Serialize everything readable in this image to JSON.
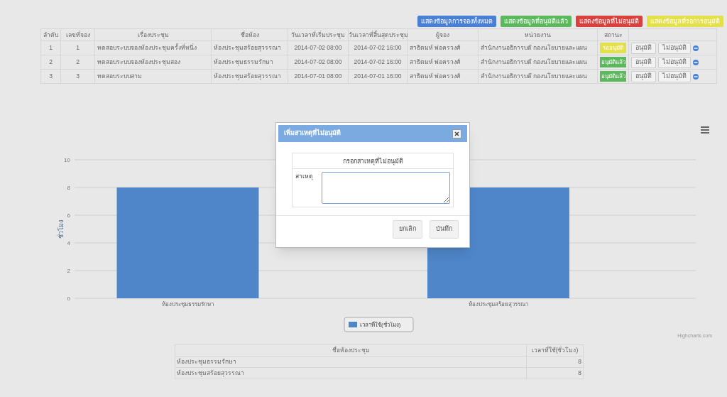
{
  "filter_buttons": [
    {
      "label": "แสดงข้อมูลการจองทั้งหมด",
      "color": "#4a7fd6"
    },
    {
      "label": "แสดงข้อมูลที่อนุมัติแล้ว",
      "color": "#5cb85c"
    },
    {
      "label": "แสดงข้อมูลที่ไม่อนุมัติ",
      "color": "#d9413f"
    },
    {
      "label": "แสดงข้อมูลที่รอการอนุมัติ",
      "color": "#e3e04a"
    }
  ],
  "bookings": {
    "columns": [
      "ลำดับ",
      "เลขที่จอง",
      "เรื่องประชุม",
      "ชื่อห้อง",
      "วันเวลาที่เริ่มประชุม",
      "วันเวลาที่สิ้นสุดประชุม",
      "ผู้จอง",
      "หน่วยงาน",
      "สถานะ"
    ],
    "rows": [
      {
        "cells": [
          "1",
          "1",
          "ทดสอบระบบจองห้องประชุมครั้งที่หนึ่ง",
          "ห้องประชุมสร้อยสุวรรณา",
          "2014-07-02 08:00",
          "2014-07-02 16:00",
          "สาธิตมห์ พ่อครวงศ์",
          "สำนักงานอธิการบดี กองนโยบายและแผน"
        ],
        "status": {
          "text": "รออนุมัติ",
          "color": "#e3e04a"
        },
        "approve": "อนุมัติ",
        "reject": "ไม่อนุมัติ"
      },
      {
        "cells": [
          "2",
          "2",
          "ทดสอบระบบจองห้องประชุมสอง",
          "ห้องประชุมธรรมรักษา",
          "2014-07-02 08:00",
          "2014-07-02 16:00",
          "สาธิตมห์ พ่อครวงศ์",
          "สำนักงานอธิการบดี กองนโยบายและแผน"
        ],
        "status": {
          "text": "อนุมัติแล้ว",
          "color": "#5cb85c"
        },
        "approve": "อนุมัติ",
        "reject": "ไม่อนุมัติ"
      },
      {
        "cells": [
          "3",
          "3",
          "ทดสอบระบบสาม",
          "ห้องประชุมสร้อยสุวรรณา",
          "2014-07-01 08:00",
          "2014-07-01 16:00",
          "สาธิตมห์ พ่อครวงศ์",
          "สำนักงานอธิการบดี กองนโยบายและแผน"
        ],
        "status": {
          "text": "อนุมัติแล้ว",
          "color": "#5cb85c"
        },
        "approve": "อนุมัติ",
        "reject": "ไม่อนุมัติ"
      }
    ]
  },
  "chart": {
    "credits": "Highcharts.com",
    "chart_data": {
      "type": "bar",
      "grid": true,
      "ylabel": "ชั่วโมง",
      "categories": [
        "ห้องประชุมธรรมรักษา",
        "ห้องประชุมสร้อยสุวรรณา"
      ],
      "series": [
        {
          "name": "เวลาที่ใช้(ชั่วโมง)",
          "color": "#4f86c9",
          "values": [
            8,
            8
          ]
        }
      ],
      "ylim": [
        0,
        10
      ],
      "yticks": [
        0,
        2,
        4,
        6,
        8,
        10
      ]
    }
  },
  "summary": {
    "columns": [
      "ชื่อห้องประชุม",
      "เวลาที่ใช้(ชั่วโมง)"
    ],
    "rows": [
      [
        "ห้องประชุมธรรมรักษา",
        "8"
      ],
      [
        "ห้องประชุมสร้อยสุวรรณา",
        "8"
      ]
    ]
  },
  "dialog": {
    "title": "เพิ่มสาเหตุที่ไม่อนุมัติ",
    "heading": "กรอกสาเหตุที่ไม่อนุมัติ",
    "field_label": "สาเหตุ",
    "buttons": [
      "ยกเลิก",
      "บันทึก"
    ]
  }
}
